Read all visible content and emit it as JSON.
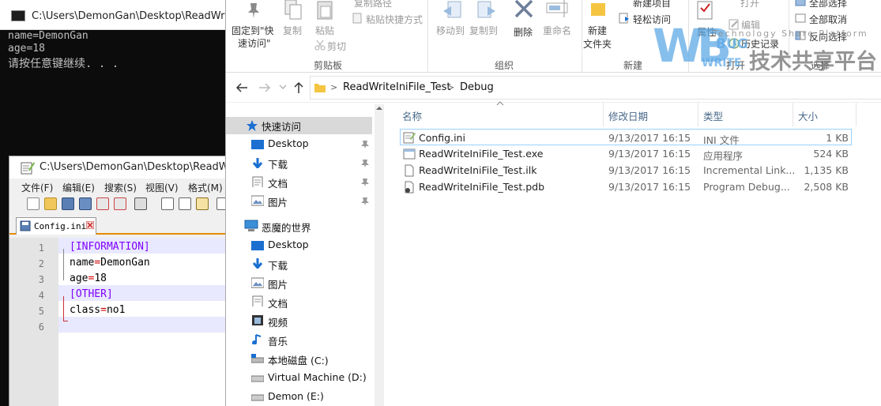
{
  "console": {
    "title": "C:\\Users\\DemonGan\\Desktop\\ReadWrite",
    "lines": [
      "name=DemonGan",
      "age=18",
      "请按任意键继续. . ."
    ]
  },
  "notepad": {
    "title": "C:\\Users\\DemonGan\\Desktop\\ReadWrite",
    "menu": [
      "文件(F)",
      "编辑(E)",
      "搜索(S)",
      "视图(V)",
      "格式(M)"
    ],
    "tab": "Config.ini",
    "line_numbers": [
      "1",
      "2",
      "3",
      "4",
      "5",
      "6"
    ],
    "code": {
      "l1": "[INFORMATION]",
      "l2a": "name",
      "l2b": "=",
      "l2c": "DemonGan",
      "l3a": "age",
      "l3b": "=",
      "l3c": "18",
      "l4": "[OTHER]",
      "l5a": "class",
      "l5b": "=",
      "l5c": "no1"
    }
  },
  "ribbon": {
    "pin_label_1": "固定到\"快",
    "pin_label_2": "速访问\"",
    "copy": "复制",
    "paste": "粘贴",
    "copy_path": "复制路径",
    "paste_shortcut": "粘贴快捷方式",
    "cut": "剪切",
    "group_clipboard": "剪贴板",
    "move_to": "移动到",
    "copy_to": "复制到",
    "delete": "删除",
    "rename": "重命名",
    "group_organize": "组织",
    "new_folder_1": "新建",
    "new_folder_2": "文件夹",
    "new_item": "新建项目",
    "easy_access": "轻松访问",
    "group_new": "新建",
    "properties": "属性",
    "open": "打开",
    "edit": "编辑",
    "history": "历史记录",
    "group_open": "打开",
    "select_all": "全部选择",
    "select_none": "全部取消",
    "invert_selection": "反向选择",
    "group_select": "选择"
  },
  "address": {
    "crumb1": "ReadWriteIniFile_Test",
    "sep": ">",
    "crumb2": "Debug"
  },
  "nav": {
    "quick_access": "快速访问",
    "qa_items": [
      "Desktop",
      "下载",
      "文档",
      "图片"
    ],
    "this_pc": "恶魔的世界",
    "pc_items": [
      "Desktop",
      "下载",
      "图片",
      "文档",
      "视频",
      "音乐",
      "本地磁盘 (C:)",
      "Virtual Machine (D:)",
      "Demon (E:)"
    ]
  },
  "columns": {
    "name": "名称",
    "date": "修改日期",
    "type": "类型",
    "size": "大小"
  },
  "files": [
    {
      "name": "Config.ini",
      "date": "9/13/2017 16:15",
      "type": "INI 文件",
      "size": "1 KB"
    },
    {
      "name": "ReadWriteIniFile_Test.exe",
      "date": "9/13/2017 16:15",
      "type": "应用程序",
      "size": "524 KB"
    },
    {
      "name": "ReadWriteIniFile_Test.ilk",
      "date": "9/13/2017 16:15",
      "type": "Incremental Link...",
      "size": "1,135 KB"
    },
    {
      "name": "ReadWriteIniFile_Test.pdb",
      "date": "9/13/2017 16:15",
      "type": "Program Debug...",
      "size": "2,508 KB"
    }
  ],
  "watermark": {
    "line1": "Technology Share Platform",
    "line2": "技术共享平台",
    "bug": "BUG",
    "write": "WRITE"
  },
  "colors": {
    "ini_section": "#8000ff",
    "ini_value": "#000000",
    "accent_blue": "#1a6fd1",
    "selection": "#cce8ff",
    "folder_yellow": "#f5c542"
  }
}
